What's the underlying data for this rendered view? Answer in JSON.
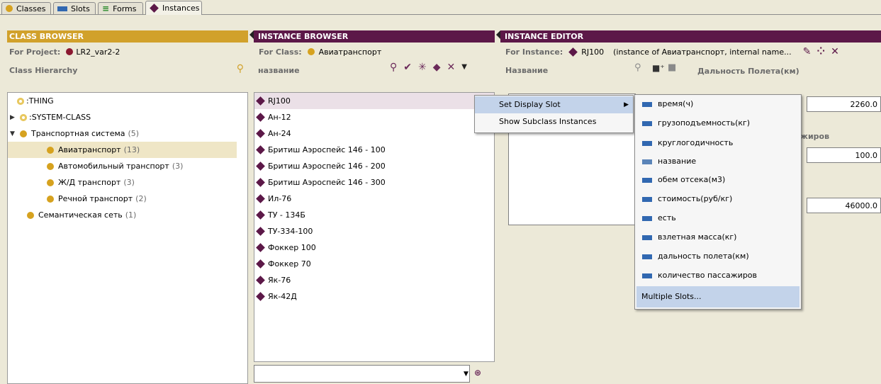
{
  "tabs": [
    {
      "label": "Classes",
      "icon": "class-dot-icon"
    },
    {
      "label": "Slots",
      "icon": "slot-bar-icon"
    },
    {
      "label": "Forms",
      "icon": "form-lines-icon"
    },
    {
      "label": "Instances",
      "icon": "instance-diamond-icon"
    }
  ],
  "class_browser": {
    "title": "CLASS BROWSER",
    "project_label": "For Project:",
    "project_name": "LR2_var2-2",
    "hierarchy_label": "Class Hierarchy",
    "tree": [
      {
        "label": ":THING",
        "count": ""
      },
      {
        "label": ":SYSTEM-CLASS",
        "count": ""
      },
      {
        "label": "Транспортная система",
        "count": "(5)"
      },
      {
        "label": "Авиатранспорт",
        "count": "(13)"
      },
      {
        "label": "Автомобильный транспорт",
        "count": "(3)"
      },
      {
        "label": "Ж/Д транспорт",
        "count": "(3)"
      },
      {
        "label": "Речной транспорт",
        "count": "(2)"
      },
      {
        "label": "Семантическая сеть",
        "count": "(1)"
      }
    ]
  },
  "instance_browser": {
    "title": "INSTANCE BROWSER",
    "class_label": "For Class:",
    "class_name": "Авиатранспорт",
    "column_label": "название",
    "instances": [
      "RJ100",
      "Ан-12",
      "Ан-24",
      "Бритиш Аэроспейс 146 - 100",
      "Бритиш Аэроспейс 146 - 200",
      "Бритиш Аэроспейс 146 - 300",
      "Ил-76",
      "ТУ - 134Б",
      "ТУ-334-100",
      "Фоккер 100",
      "Фоккер 70",
      "Як-76",
      "Як-42Д"
    ],
    "search_value": ""
  },
  "instance_editor": {
    "title": "INSTANCE EDITOR",
    "instance_label": "For Instance:",
    "instance_name": "RJ100",
    "instance_desc": "(instance of Авиатранспорт, internal name...",
    "name_label": "Название",
    "range_label": "Дальность Полета(км)",
    "partial_label": "жиров",
    "values": [
      "2260.0",
      "100.0",
      "46000.0"
    ]
  },
  "context_menu": {
    "items": [
      "Set Display Slot",
      "Show Subclass Instances"
    ]
  },
  "slot_submenu": {
    "items": [
      "время(ч)",
      "грузоподъемность(кг)",
      "круглогодичность",
      "название",
      "обем отсека(м3)",
      "стоимость(руб/кг)",
      "есть",
      "взлетная масса(кг)",
      "дальность полета(км)",
      "количество пассажиров"
    ],
    "multiple": "Multiple Slots..."
  },
  "colors": {
    "class_header": "#d1a12b",
    "instance_header": "#5c1848",
    "slot_icon": "#3168b1",
    "menu_highlight": "#c3d3ea"
  }
}
